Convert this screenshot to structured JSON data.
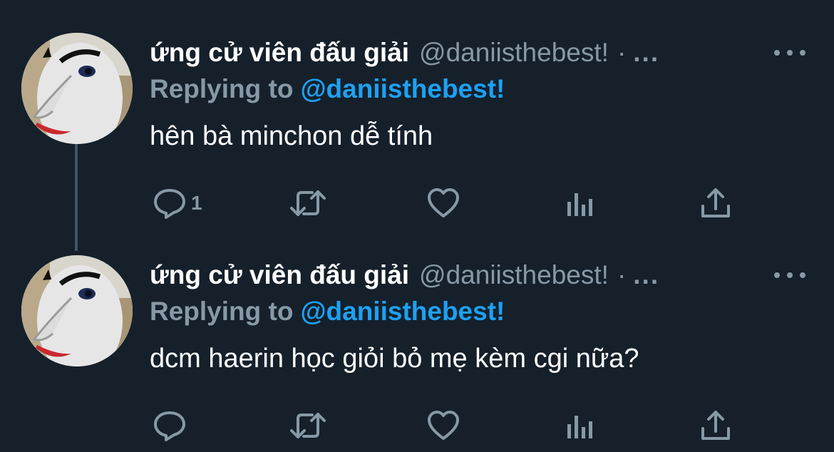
{
  "tweets": [
    {
      "display_name": "ứng cử viên đấu giải",
      "handle": "@daniisthebest!",
      "separator": "·",
      "truncated": "...",
      "replying_prefix": "Replying to",
      "replying_mention": "@daniisthebest!",
      "text": "hên bà minchon dễ tính",
      "reply_count": "1",
      "avatar": "cartoon-face-avatar"
    },
    {
      "display_name": "ứng cử viên đấu giải",
      "handle": "@daniisthebest!",
      "separator": "·",
      "truncated": "...",
      "replying_prefix": "Replying to",
      "replying_mention": "@daniisthebest!",
      "text": "dcm haerin học giỏi bỏ mẹ kèm cgi nữa?",
      "reply_count": "",
      "avatar": "cartoon-face-avatar"
    }
  ],
  "icons": {
    "reply": "reply-icon",
    "retweet": "retweet-icon",
    "like": "like-icon",
    "analytics": "analytics-icon",
    "share": "share-icon",
    "more": "more-options-icon"
  },
  "colors": {
    "background": "#15202b",
    "text": "#ffffff",
    "secondary": "#8899a6",
    "accent": "#1da1f2",
    "thread_line": "#3d5466"
  }
}
